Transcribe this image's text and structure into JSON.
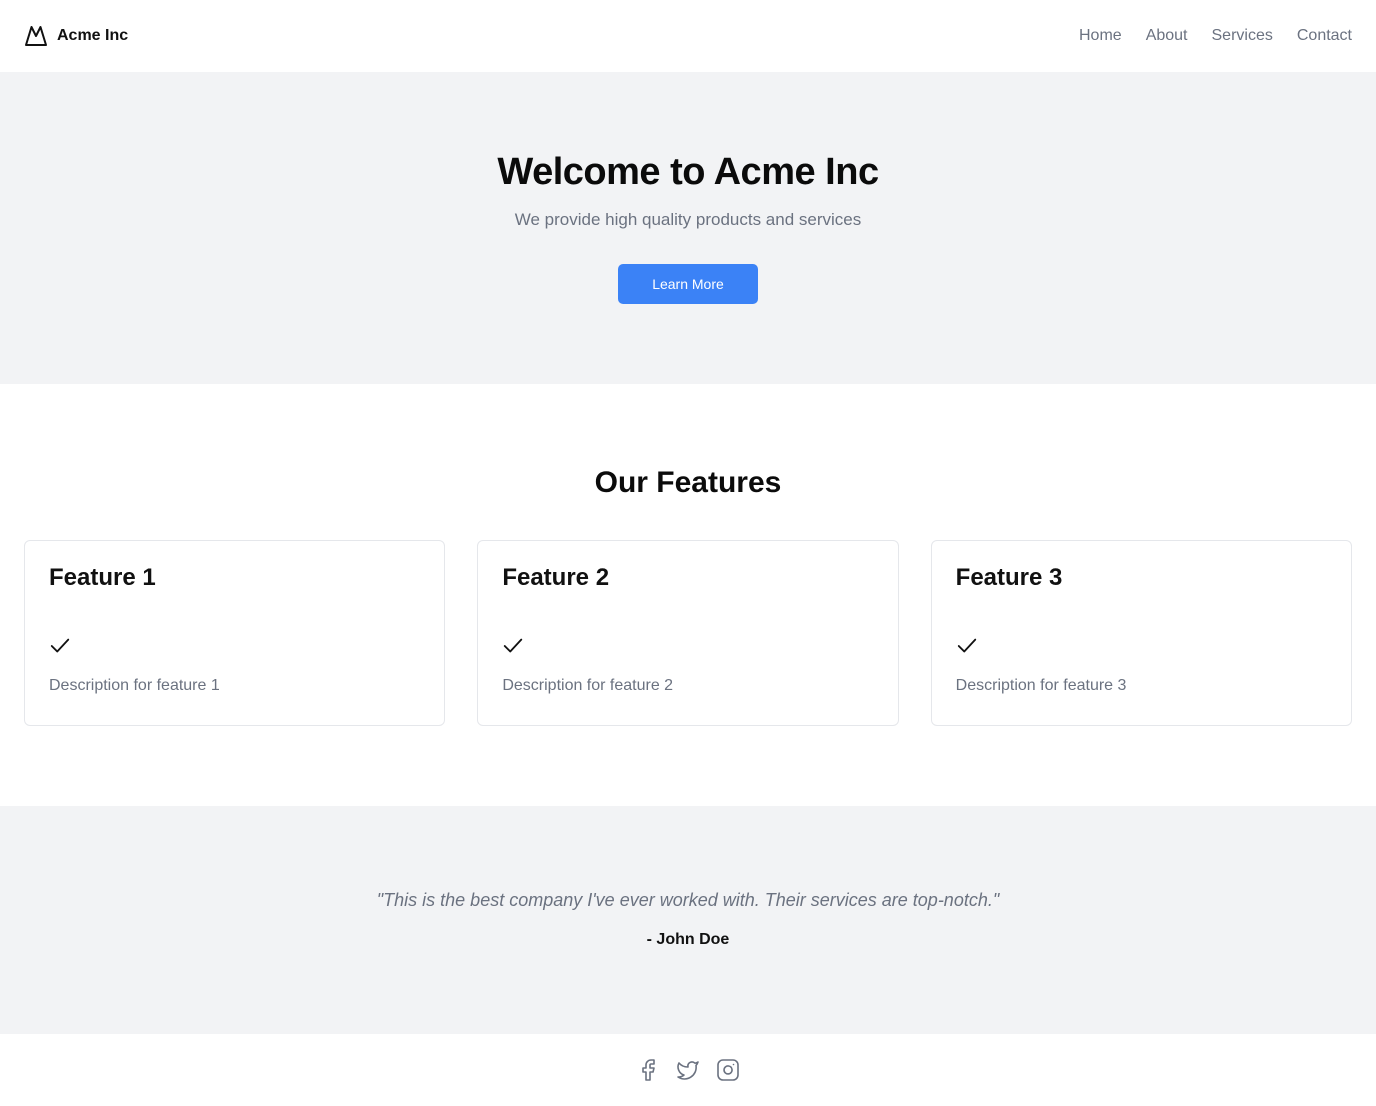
{
  "header": {
    "brand_name": "Acme Inc",
    "nav": [
      "Home",
      "About",
      "Services",
      "Contact"
    ]
  },
  "hero": {
    "title": "Welcome to Acme Inc",
    "subtitle": "We provide high quality products and services",
    "button_label": "Learn More"
  },
  "features": {
    "title": "Our Features",
    "items": [
      {
        "title": "Feature 1",
        "description": "Description for feature 1",
        "icon": "check-icon"
      },
      {
        "title": "Feature 2",
        "description": "Description for feature 2",
        "icon": "check-icon"
      },
      {
        "title": "Feature 3",
        "description": "Description for feature 3",
        "icon": "check-icon"
      }
    ]
  },
  "testimonial": {
    "quote": "\"This is the best company I've ever worked with. Their services are top-notch.\"",
    "author": "- John Doe"
  },
  "footer": {
    "social_icons": [
      "facebook-icon",
      "twitter-icon",
      "instagram-icon"
    ]
  },
  "colors": {
    "accent": "#3b82f6",
    "section_bg": "#f2f3f5",
    "muted_text": "#6b7280"
  }
}
